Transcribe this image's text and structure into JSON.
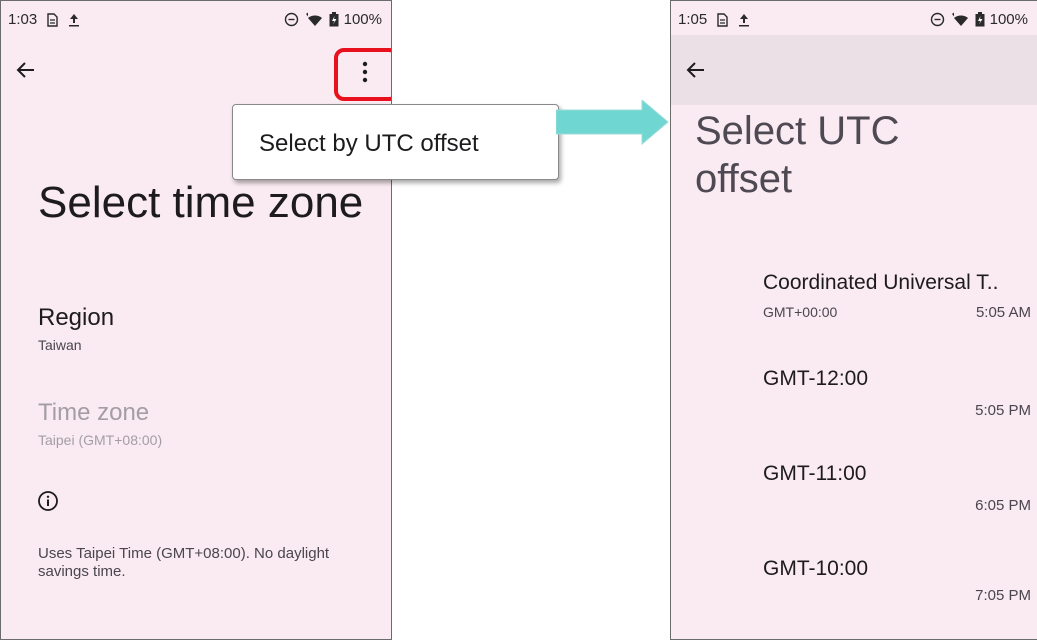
{
  "left_screen": {
    "status": {
      "time": "1:03",
      "battery": "100%"
    },
    "menu_popup": {
      "item": "Select by UTC offset"
    },
    "title": "Select time zone",
    "region": {
      "title": "Region",
      "value": "Taiwan"
    },
    "time_zone": {
      "title": "Time zone",
      "value": "Taipei (GMT+08:00)"
    },
    "footer": "Uses Taipei Time (GMT+08:00). No daylight savings time."
  },
  "right_screen": {
    "status": {
      "time": "1:05",
      "battery": "100%"
    },
    "title_line1": "Select UTC",
    "title_line2": "offset",
    "zones": [
      {
        "name": "Coordinated Universal T..",
        "offset": "GMT+00:00",
        "time": "5:05 AM"
      },
      {
        "name": "GMT-12:00",
        "offset": "",
        "time": "5:05 PM"
      },
      {
        "name": "GMT-11:00",
        "offset": "",
        "time": "6:05 PM"
      },
      {
        "name": "GMT-10:00",
        "offset": "",
        "time": "7:05 PM"
      }
    ]
  },
  "colors": {
    "screen_bg": "#f9ebf1",
    "app_bar_bg": "#ebe0e6",
    "highlight": "#e8101c",
    "arrow": "#6fd6d2"
  },
  "icons": [
    "sim-icon",
    "upload-icon",
    "dnd-icon",
    "wifi-icon",
    "battery-icon",
    "back-arrow-icon",
    "more-vert-icon",
    "info-icon"
  ]
}
